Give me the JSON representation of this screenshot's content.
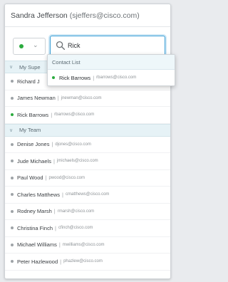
{
  "colors": {
    "available": "#2bab3e",
    "offline": "#9ea3a7",
    "accent": "#3a9fd6"
  },
  "header": {
    "name": "Sandra Jefferson",
    "email": "(sjeffers@cisco.com)"
  },
  "status": {
    "icon": "chevron-down-icon"
  },
  "search": {
    "icon": "search-icon",
    "value": "Rick"
  },
  "dropdown": {
    "section_label": "Contact List",
    "results": [
      {
        "name": "Rick Barrows",
        "separator": "|",
        "email": "rbarrows@cisco.com"
      }
    ]
  },
  "groups": [
    {
      "label": "My Supe",
      "contacts": [
        {
          "name": "Richard J",
          "separator": "",
          "email": ""
        },
        {
          "name": "James Newman",
          "separator": "|",
          "email": "jnewman@cisco.com"
        },
        {
          "name": "Rick Barrows",
          "separator": "|",
          "email": "rbarrows@cisco.com"
        }
      ]
    },
    {
      "label": "My Team",
      "contacts": [
        {
          "name": "Denise Jones",
          "separator": "|",
          "email": "djones@cisco.com"
        },
        {
          "name": "Jude Michaels",
          "separator": "|",
          "email": "jmichaels@cisco.com"
        },
        {
          "name": "Paul Wood",
          "separator": "|",
          "email": "pwood@cisco.com"
        },
        {
          "name": "Charles Matthews",
          "separator": "|",
          "email": "cmatthews@cisco.com"
        },
        {
          "name": "Rodney Marsh",
          "separator": "|",
          "email": "rmarsh@cisco.com"
        },
        {
          "name": "Christina Finch",
          "separator": "|",
          "email": "cfinch@cisco.com"
        },
        {
          "name": "Michael Williams",
          "separator": "|",
          "email": "mwilliams@cisco.com"
        },
        {
          "name": "Peter Hazlewood",
          "separator": "|",
          "email": "phazlew@cisco.com"
        }
      ]
    }
  ]
}
